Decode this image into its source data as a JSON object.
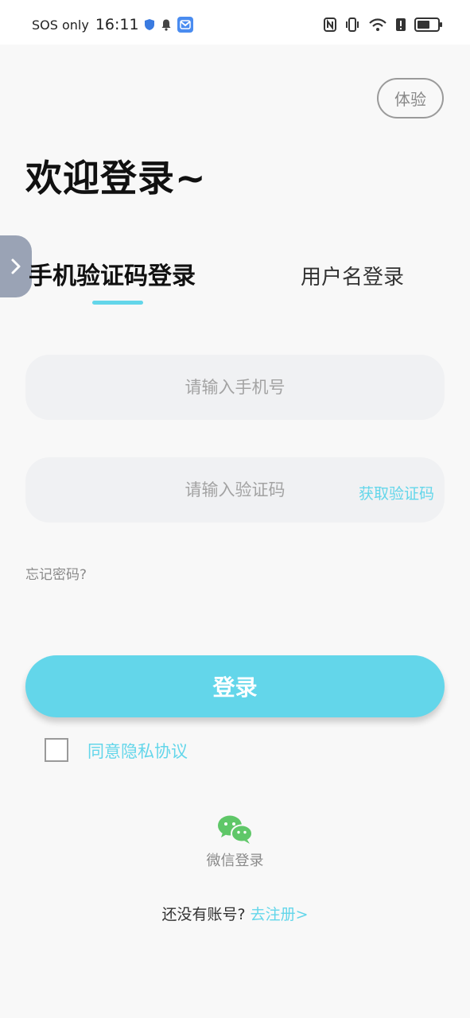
{
  "status_bar": {
    "carrier": "SOS only",
    "time": "16:11",
    "icons": [
      "shield-icon",
      "bell-icon",
      "app-notification-icon",
      "nfc-icon",
      "vibrate-icon",
      "wifi-icon",
      "alert-icon",
      "battery-icon"
    ],
    "battery_level": 0.55
  },
  "header": {
    "trial_label": "体验",
    "welcome": "欢迎登录~"
  },
  "tabs": [
    {
      "label": "手机验证码登录",
      "active": true
    },
    {
      "label": "用户名登录",
      "active": false
    }
  ],
  "form": {
    "phone_placeholder": "请输入手机号",
    "code_placeholder": "请输入验证码",
    "get_code_label": "获取验证码",
    "forgot_label": "忘记密码?",
    "login_label": "登录",
    "agree_label": "同意隐私协议",
    "agree_checked": false
  },
  "social": {
    "wechat_label": "微信登录"
  },
  "register": {
    "prompt": "还没有账号?",
    "link": "去注册>"
  },
  "colors": {
    "accent": "#63d6ea",
    "background": "#f8f8f8",
    "input_bg": "#f0f1f3",
    "wechat_green": "#5fc768"
  }
}
